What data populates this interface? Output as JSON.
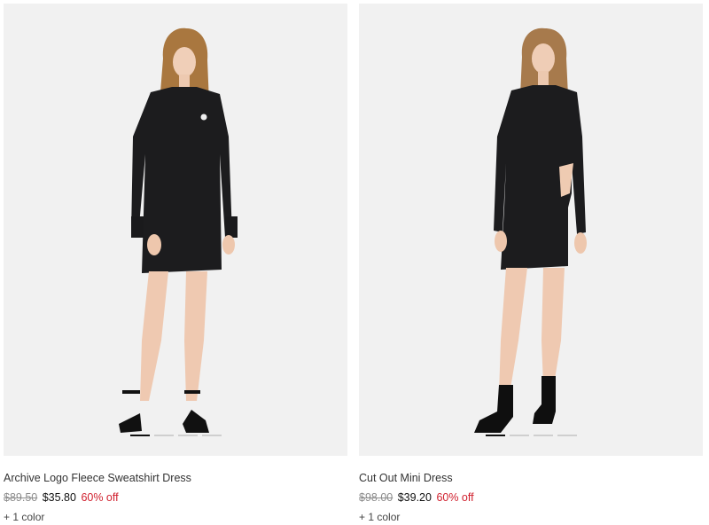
{
  "products": [
    {
      "title": "Archive Logo Fleece Sweatshirt Dress",
      "original_price": "$89.50",
      "sale_price": "$35.80",
      "discount": "60% off",
      "color_count": "+ 1 color",
      "image_alt": "Model wearing black fleece sweatshirt dress with sandals",
      "carousel_active_index": 0,
      "carousel_total": 4
    },
    {
      "title": "Cut Out Mini Dress",
      "original_price": "$98.00",
      "sale_price": "$39.20",
      "discount": "60% off",
      "color_count": "+ 1 color",
      "image_alt": "Model wearing black long-sleeve cut out mini dress with ankle boots",
      "carousel_active_index": 0,
      "carousel_total": 4
    }
  ],
  "colors": {
    "image_bg": "#f1f1f1",
    "garment": "#1c1c1e",
    "discount_red": "#d0202e",
    "strike_grey": "#8c8c8c"
  }
}
